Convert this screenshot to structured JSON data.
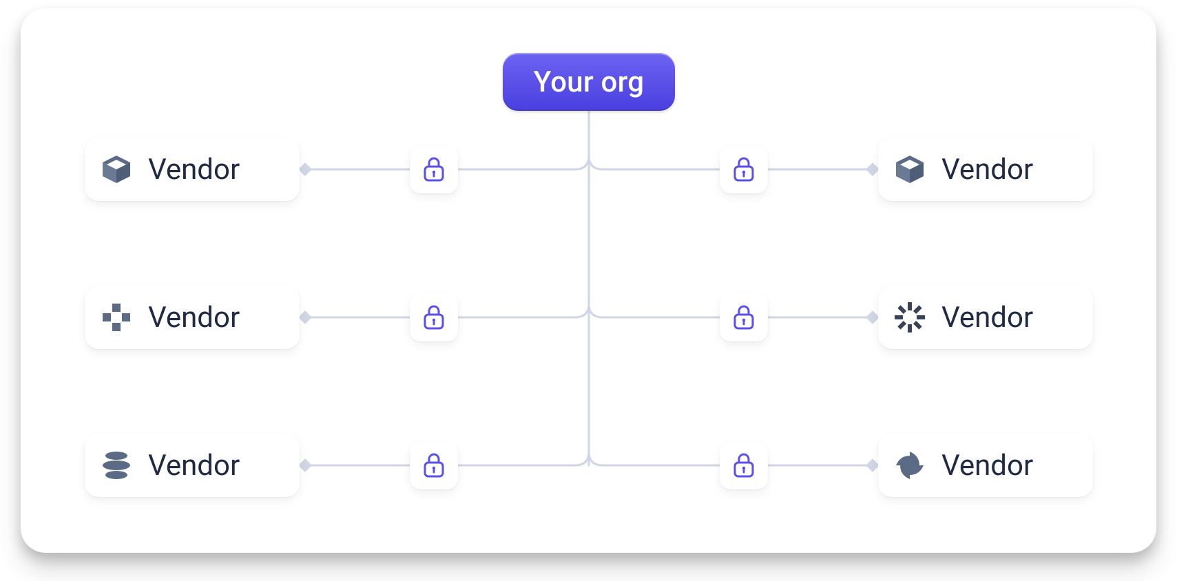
{
  "diagram": {
    "root_label": "Your org",
    "vendors": {
      "left": [
        {
          "label": "Vendor",
          "icon": "cube"
        },
        {
          "label": "Vendor",
          "icon": "pixel-plus"
        },
        {
          "label": "Vendor",
          "icon": "stack-lines"
        }
      ],
      "right": [
        {
          "label": "Vendor",
          "icon": "cube"
        },
        {
          "label": "Vendor",
          "icon": "burst"
        },
        {
          "label": "Vendor",
          "icon": "swirl"
        }
      ]
    },
    "lock_icon": "lock",
    "colors": {
      "accent": "#5b51e8",
      "line": "#cfd6e4",
      "vendor_icon": "#5b6b86",
      "text": "#1f2a44"
    }
  }
}
